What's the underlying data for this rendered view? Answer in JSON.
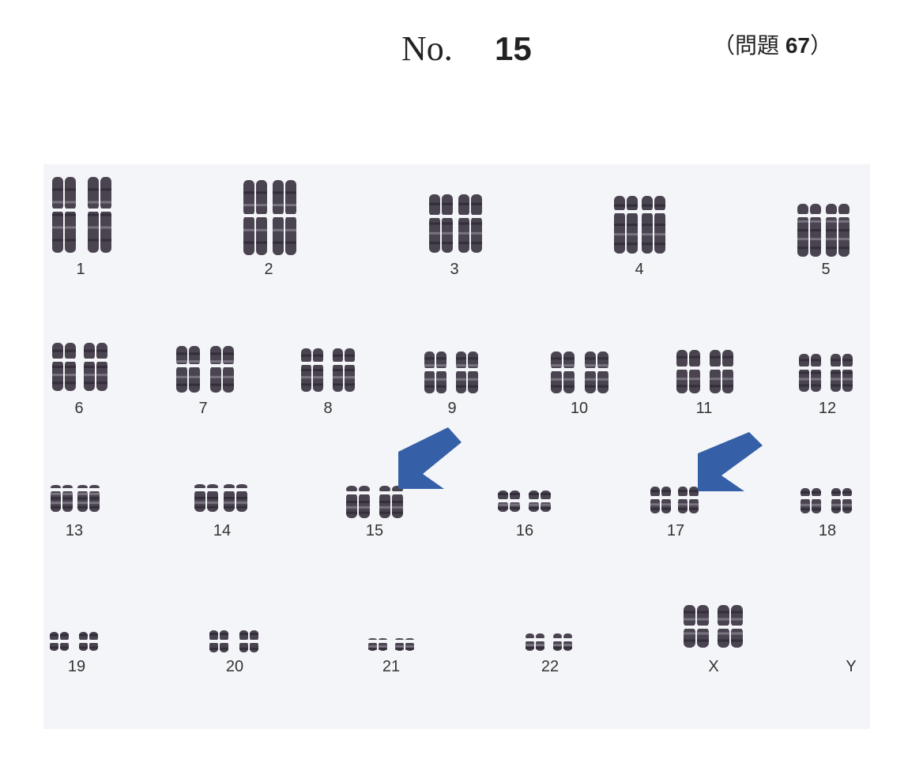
{
  "header": {
    "no_label": "No.",
    "no_value": "15",
    "question_ref_open": "（",
    "question_ref_text": "問題",
    "question_ref_num": "67",
    "question_ref_close": "）"
  },
  "karyotype": {
    "labels": {
      "c1": "1",
      "c2": "2",
      "c3": "3",
      "c4": "4",
      "c5": "5",
      "c6": "6",
      "c7": "7",
      "c8": "8",
      "c9": "9",
      "c10": "10",
      "c11": "11",
      "c12": "12",
      "c13": "13",
      "c14": "14",
      "c15": "15",
      "c16": "16",
      "c17": "17",
      "c18": "18",
      "c19": "19",
      "c20": "20",
      "c21": "21",
      "c22": "22",
      "cX": "X",
      "cY": "Y"
    },
    "arrow_color": "#3560a8",
    "chromosome_color": "#4a4450"
  }
}
